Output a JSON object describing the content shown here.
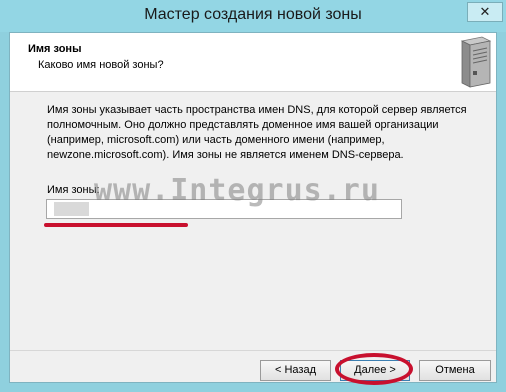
{
  "window": {
    "title": "Мастер создания новой зоны",
    "close_label": "✕"
  },
  "header": {
    "title": "Имя зоны",
    "subtitle": "Каково имя новой зоны?"
  },
  "body": {
    "description": "Имя зоны указывает часть пространства имен DNS, для которой сервер является полномочным. Оно должно представлять доменное имя вашей организации (например, microsoft.com) или часть доменного имени (например, newzone.microsoft.com). Имя зоны не является именем DNS-сервера.",
    "zone_name_label": "Имя зоны:",
    "zone_name_value": ""
  },
  "watermark": "www.Integrus.ru",
  "buttons": {
    "back": "< Назад",
    "next": "Далее >",
    "cancel": "Отмена"
  },
  "colors": {
    "title_bar": "#93d6e4",
    "annotation_red": "#c8102e"
  }
}
